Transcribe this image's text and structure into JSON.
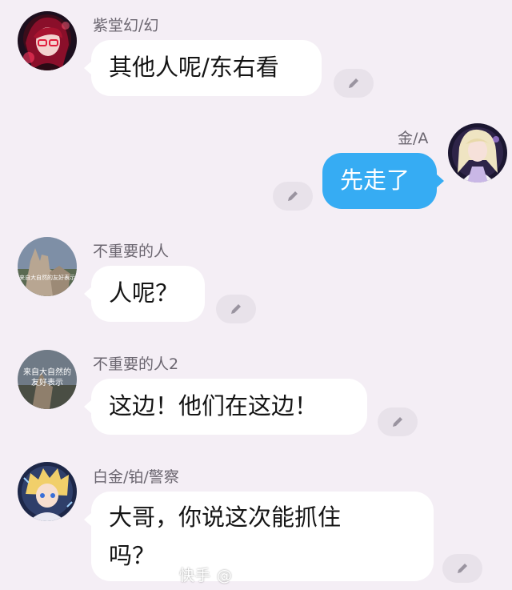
{
  "messages": [
    {
      "sender": "紫堂幻/幻",
      "text": "其他人呢/东右看",
      "avatar_icon": "anime-girl-red-glasses-avatar",
      "edit_icon": "pencil-icon"
    },
    {
      "sender": "金/A",
      "text": "先走了",
      "avatar_icon": "anime-girl-blonde-avatar",
      "edit_icon": "pencil-icon"
    },
    {
      "sender": "不重要的人",
      "text": "人呢？",
      "avatar_icon": "hand-gesture-photo-avatar",
      "avatar_caption": "来自大自然的友好表示",
      "edit_icon": "pencil-icon"
    },
    {
      "sender": "不重要的人2",
      "text": "这边！他们在这边！",
      "avatar_icon": "hand-gesture-photo-avatar",
      "avatar_caption_lines": [
        "来自大自然的",
        "友好表示"
      ],
      "edit_icon": "pencil-icon"
    },
    {
      "sender": "白金/铂/警察",
      "text_lines": [
        "大哥，你说这次能抓住",
        "吗？"
      ],
      "avatar_icon": "anime-boy-blonde-avatar",
      "edit_icon": "pencil-icon"
    }
  ],
  "watermark": "快手 @",
  "colors": {
    "background": "#f4eef5",
    "bubble": "#ffffff",
    "self_bubble": "#36acf3",
    "name_text": "#6b6670"
  }
}
